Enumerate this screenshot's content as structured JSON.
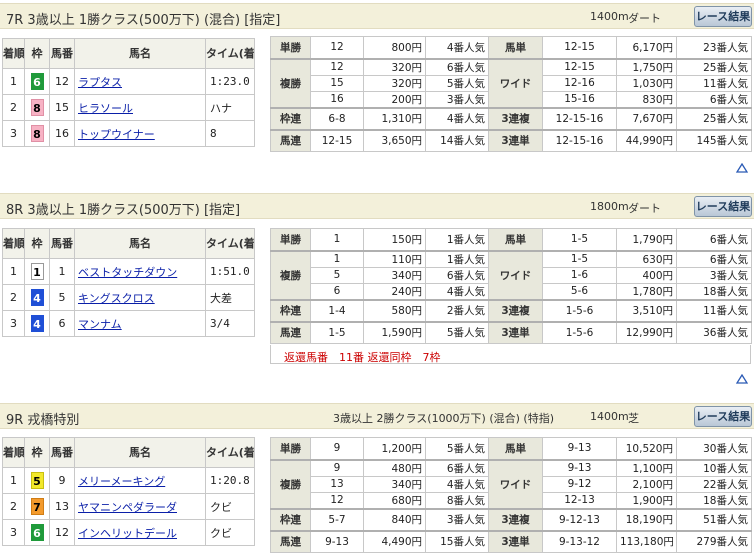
{
  "result_button_label": "レース結果",
  "headers": {
    "rank": "着順",
    "waku": "枠",
    "umaban": "馬番",
    "horse": "馬名",
    "time": "タイム(着差)"
  },
  "waku_colors": {
    "1": {
      "bg": "#ffffff",
      "fg": "#000000",
      "border": "#999999"
    },
    "4": {
      "bg": "#1f4fd6",
      "fg": "#ffffff",
      "border": "#1f4fd6"
    },
    "5": {
      "bg": "#f2e82a",
      "fg": "#000000",
      "border": "#c8bf10"
    },
    "6": {
      "bg": "#1f9a3a",
      "fg": "#ffffff",
      "border": "#1f9a3a"
    },
    "7": {
      "bg": "#f39a2c",
      "fg": "#000000",
      "border": "#d07d15"
    },
    "8": {
      "bg": "#f7b2c4",
      "fg": "#000000",
      "border": "#e090a5"
    }
  },
  "races": [
    {
      "title": "7R 3歳以上 1勝クラス(500万下) (混合) [指定]",
      "conditions": "",
      "distance": "1400m",
      "surface": "ダート",
      "results": [
        {
          "rank": "1",
          "waku": "6",
          "umaban": "12",
          "horse": "ラプタス",
          "time": "1:23.0"
        },
        {
          "rank": "2",
          "waku": "8",
          "umaban": "15",
          "horse": "ヒラソール",
          "time": "ハナ"
        },
        {
          "rank": "3",
          "waku": "8",
          "umaban": "16",
          "horse": "トップウイナー",
          "time": "8"
        }
      ],
      "payouts": [
        {
          "left": {
            "type": "単勝",
            "combo": "12",
            "payout": "800円",
            "pop": "4番人気"
          },
          "right": {
            "type": "馬単",
            "combo": "12-15",
            "payout": "6,170円",
            "pop": "23番人気"
          }
        },
        {
          "left": {
            "type": "複勝",
            "combo": "12",
            "payout": "320円",
            "pop": "6番人気"
          },
          "right": {
            "type": "ワイド",
            "combo": "12-15",
            "payout": "1,750円",
            "pop": "25番人気"
          }
        },
        {
          "left": {
            "type": "",
            "combo": "15",
            "payout": "320円",
            "pop": "5番人気"
          },
          "right": {
            "type": "",
            "combo": "12-16",
            "payout": "1,030円",
            "pop": "11番人気"
          }
        },
        {
          "left": {
            "type": "",
            "combo": "16",
            "payout": "200円",
            "pop": "3番人気"
          },
          "right": {
            "type": "",
            "combo": "15-16",
            "payout": "830円",
            "pop": "6番人気"
          }
        },
        {
          "left": {
            "type": "枠連",
            "combo": "6-8",
            "payout": "1,310円",
            "pop": "4番人気"
          },
          "right": {
            "type": "3連複",
            "combo": "12-15-16",
            "payout": "7,670円",
            "pop": "25番人気"
          }
        },
        {
          "left": {
            "type": "馬連",
            "combo": "12-15",
            "payout": "3,650円",
            "pop": "14番人気"
          },
          "right": {
            "type": "3連単",
            "combo": "12-15-16",
            "payout": "44,990円",
            "pop": "145番人気"
          }
        }
      ],
      "refund": ""
    },
    {
      "title": "8R 3歳以上 1勝クラス(500万下) [指定]",
      "conditions": "",
      "distance": "1800m",
      "surface": "ダート",
      "results": [
        {
          "rank": "1",
          "waku": "1",
          "umaban": "1",
          "horse": "ベストタッチダウン",
          "time": "1:51.0"
        },
        {
          "rank": "2",
          "waku": "4",
          "umaban": "5",
          "horse": "キングスクロス",
          "time": "大差"
        },
        {
          "rank": "3",
          "waku": "4",
          "umaban": "6",
          "horse": "マンナム",
          "time": "3/4"
        }
      ],
      "payouts": [
        {
          "left": {
            "type": "単勝",
            "combo": "1",
            "payout": "150円",
            "pop": "1番人気"
          },
          "right": {
            "type": "馬単",
            "combo": "1-5",
            "payout": "1,790円",
            "pop": "6番人気"
          }
        },
        {
          "left": {
            "type": "複勝",
            "combo": "1",
            "payout": "110円",
            "pop": "1番人気"
          },
          "right": {
            "type": "ワイド",
            "combo": "1-5",
            "payout": "630円",
            "pop": "6番人気"
          }
        },
        {
          "left": {
            "type": "",
            "combo": "5",
            "payout": "340円",
            "pop": "6番人気"
          },
          "right": {
            "type": "",
            "combo": "1-6",
            "payout": "400円",
            "pop": "3番人気"
          }
        },
        {
          "left": {
            "type": "",
            "combo": "6",
            "payout": "240円",
            "pop": "4番人気"
          },
          "right": {
            "type": "",
            "combo": "5-6",
            "payout": "1,780円",
            "pop": "18番人気"
          }
        },
        {
          "left": {
            "type": "枠連",
            "combo": "1-4",
            "payout": "580円",
            "pop": "2番人気"
          },
          "right": {
            "type": "3連複",
            "combo": "1-5-6",
            "payout": "3,510円",
            "pop": "11番人気"
          }
        },
        {
          "left": {
            "type": "馬連",
            "combo": "1-5",
            "payout": "1,590円",
            "pop": "5番人気"
          },
          "right": {
            "type": "3連単",
            "combo": "1-5-6",
            "payout": "12,990円",
            "pop": "36番人気"
          }
        }
      ],
      "refund": "返還馬番　11番 返還同枠　7枠"
    },
    {
      "title": "9R 戎橋特別",
      "conditions": "3歳以上 2勝クラス(1000万下) (混合) (特指)",
      "distance": "1400m",
      "surface": "芝",
      "results": [
        {
          "rank": "1",
          "waku": "5",
          "umaban": "9",
          "horse": "メリーメーキング",
          "time": "1:20.8"
        },
        {
          "rank": "2",
          "waku": "7",
          "umaban": "13",
          "horse": "ヤマニンペダラーダ",
          "time": "クビ"
        },
        {
          "rank": "3",
          "waku": "6",
          "umaban": "12",
          "horse": "インヘリットデール",
          "time": "クビ"
        }
      ],
      "payouts": [
        {
          "left": {
            "type": "単勝",
            "combo": "9",
            "payout": "1,200円",
            "pop": "5番人気"
          },
          "right": {
            "type": "馬単",
            "combo": "9-13",
            "payout": "10,520円",
            "pop": "30番人気"
          }
        },
        {
          "left": {
            "type": "複勝",
            "combo": "9",
            "payout": "480円",
            "pop": "6番人気"
          },
          "right": {
            "type": "ワイド",
            "combo": "9-13",
            "payout": "1,100円",
            "pop": "10番人気"
          }
        },
        {
          "left": {
            "type": "",
            "combo": "13",
            "payout": "340円",
            "pop": "4番人気"
          },
          "right": {
            "type": "",
            "combo": "9-12",
            "payout": "2,100円",
            "pop": "22番人気"
          }
        },
        {
          "left": {
            "type": "",
            "combo": "12",
            "payout": "680円",
            "pop": "8番人気"
          },
          "right": {
            "type": "",
            "combo": "12-13",
            "payout": "1,900円",
            "pop": "18番人気"
          }
        },
        {
          "left": {
            "type": "枠連",
            "combo": "5-7",
            "payout": "840円",
            "pop": "3番人気"
          },
          "right": {
            "type": "3連複",
            "combo": "9-12-13",
            "payout": "18,190円",
            "pop": "51番人気"
          }
        },
        {
          "left": {
            "type": "馬連",
            "combo": "9-13",
            "payout": "4,490円",
            "pop": "15番人気"
          },
          "right": {
            "type": "3連単",
            "combo": "9-13-12",
            "payout": "113,180円",
            "pop": "279番人気"
          }
        }
      ],
      "refund": ""
    }
  ]
}
